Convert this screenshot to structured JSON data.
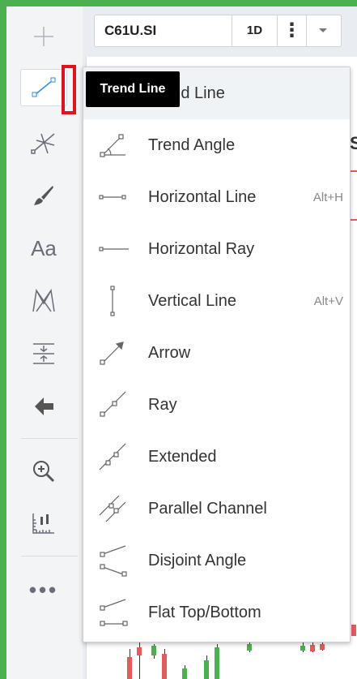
{
  "header": {
    "symbol": "C61U.SI",
    "interval": "1D",
    "more_glyph": "⋮"
  },
  "tooltip": "Trend Line",
  "toolbar": {
    "items": [
      {
        "icon": "crosshair-icon"
      },
      {
        "icon": "trend-line-icon",
        "active": true
      },
      {
        "icon": "pitchfork-icon"
      },
      {
        "icon": "brush-icon"
      },
      {
        "icon": "text-icon",
        "glyph": "Aa"
      },
      {
        "icon": "pattern-icon"
      },
      {
        "icon": "measure-icon"
      },
      {
        "icon": "arrow-left-icon"
      },
      {
        "icon": "zoom-in-icon"
      },
      {
        "icon": "ruler-icon"
      },
      {
        "icon": "more-icon",
        "glyph": "•••"
      }
    ]
  },
  "menu": {
    "items": [
      {
        "label": "Trend Line",
        "shortcut": "",
        "icon": "trend-line-icon",
        "selected": true
      },
      {
        "label": "Trend Angle",
        "shortcut": "",
        "icon": "trend-angle-icon"
      },
      {
        "label": "Horizontal Line",
        "shortcut": "Alt+H",
        "icon": "horizontal-line-icon"
      },
      {
        "label": "Horizontal Ray",
        "shortcut": "",
        "icon": "horizontal-ray-icon"
      },
      {
        "label": "Vertical Line",
        "shortcut": "Alt+V",
        "icon": "vertical-line-icon"
      },
      {
        "label": "Arrow",
        "shortcut": "",
        "icon": "arrow-icon"
      },
      {
        "label": "Ray",
        "shortcut": "",
        "icon": "ray-icon"
      },
      {
        "label": "Extended",
        "shortcut": "",
        "icon": "extended-line-icon"
      },
      {
        "label": "Parallel Channel",
        "shortcut": "",
        "icon": "parallel-channel-icon"
      },
      {
        "label": "Disjoint Angle",
        "shortcut": "",
        "icon": "disjoint-angle-icon"
      },
      {
        "label": "Flat Top/Bottom",
        "shortcut": "",
        "icon": "flat-top-bottom-icon"
      }
    ]
  },
  "chart": {
    "partial_letter": "S",
    "accent_red": "#e35c5c",
    "candle_green": "#4caf50",
    "candle_red": "#e35c5c"
  },
  "colors": {
    "frame_green": "#4caf50",
    "highlight_red": "#e0121b",
    "icon_gray": "#6a6d78"
  }
}
